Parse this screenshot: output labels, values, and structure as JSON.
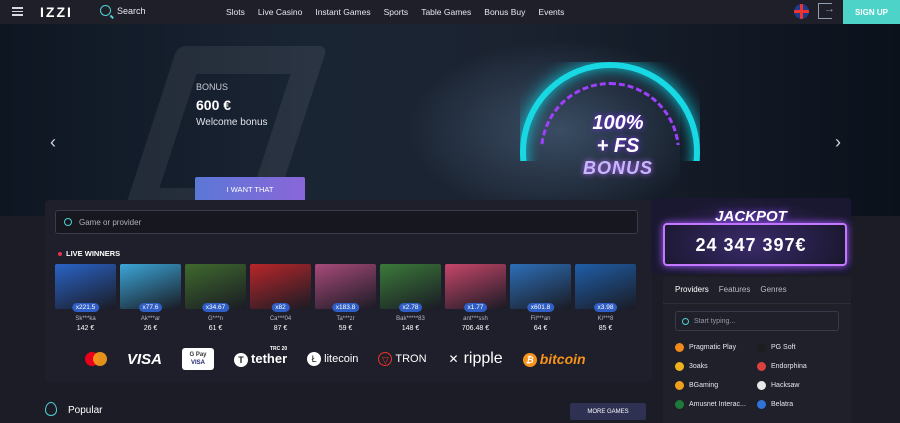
{
  "header": {
    "logo": "IZZI",
    "search_label": "Search",
    "nav": [
      "Slots",
      "Live Casino",
      "Instant Games",
      "Sports",
      "Table Games",
      "Bonus Buy",
      "Events"
    ],
    "signup": "SIGN UP"
  },
  "hero": {
    "label": "BONUS",
    "amount": "600 €",
    "subtitle": "Welcome bonus",
    "cta": "I WANT THAT",
    "art_line1": "100%",
    "art_line2": "+ FS",
    "art_line3": "BONUS"
  },
  "games": {
    "search_placeholder": "Game or provider",
    "live_winners_label": "LIVE WINNERS",
    "winners": [
      {
        "mult": "x221.5",
        "name": "Sk***ka",
        "amount": "142 €",
        "color": "#2a64c8"
      },
      {
        "mult": "x77.6",
        "name": "Ak***ar",
        "amount": "26 €",
        "color": "#3ba6d8"
      },
      {
        "mult": "x34.67",
        "name": "G***n",
        "amount": "61 €",
        "color": "#3f6a2d"
      },
      {
        "mult": "x82",
        "name": "Ca***04",
        "amount": "87 €",
        "color": "#b8262a"
      },
      {
        "mult": "x183.8",
        "name": "Ta***zr",
        "amount": "59 €",
        "color": "#a84a7a"
      },
      {
        "mult": "x2.78",
        "name": "Bak*****83",
        "amount": "148 €",
        "color": "#3b7a3a"
      },
      {
        "mult": "x1.77",
        "name": "ant***ssh",
        "amount": "706.48 €",
        "color": "#c8466a"
      },
      {
        "mult": "x601.8",
        "name": "Fil***an",
        "amount": "64 €",
        "color": "#2d6fb8"
      },
      {
        "mult": "x3.98",
        "name": "Ki***8",
        "amount": "85 €",
        "color": "#1f5ea8"
      }
    ],
    "payments": {
      "visa": "VISA",
      "gpay_top": "G Pay",
      "gpay_bottom": "VISA",
      "tether": "tether",
      "tether_sup": "TRC 20",
      "litecoin": "litecoin",
      "tron": "TRON",
      "ripple": "ripple",
      "bitcoin": "bitcoin"
    }
  },
  "popular": {
    "title": "Popular",
    "more": "MORE GAMES"
  },
  "jackpot": {
    "title": "JACKPOT",
    "amount": "24 347 397€"
  },
  "providers": {
    "tabs": [
      "Providers",
      "Features",
      "Genres"
    ],
    "search_placeholder": "Start typing...",
    "items": [
      {
        "name": "Pragmatic Play",
        "color": "#f08a1c"
      },
      {
        "name": "PG Soft",
        "color": "#1d1d1d"
      },
      {
        "name": "3oaks",
        "color": "#f0b21c"
      },
      {
        "name": "Endorphina",
        "color": "#d94040"
      },
      {
        "name": "BGaming",
        "color": "#f0a01c"
      },
      {
        "name": "Hacksaw",
        "color": "#e8e8e8"
      },
      {
        "name": "Amusnet Interac...",
        "color": "#1e7a3a"
      },
      {
        "name": "Belatra",
        "color": "#2f72d8"
      }
    ]
  }
}
